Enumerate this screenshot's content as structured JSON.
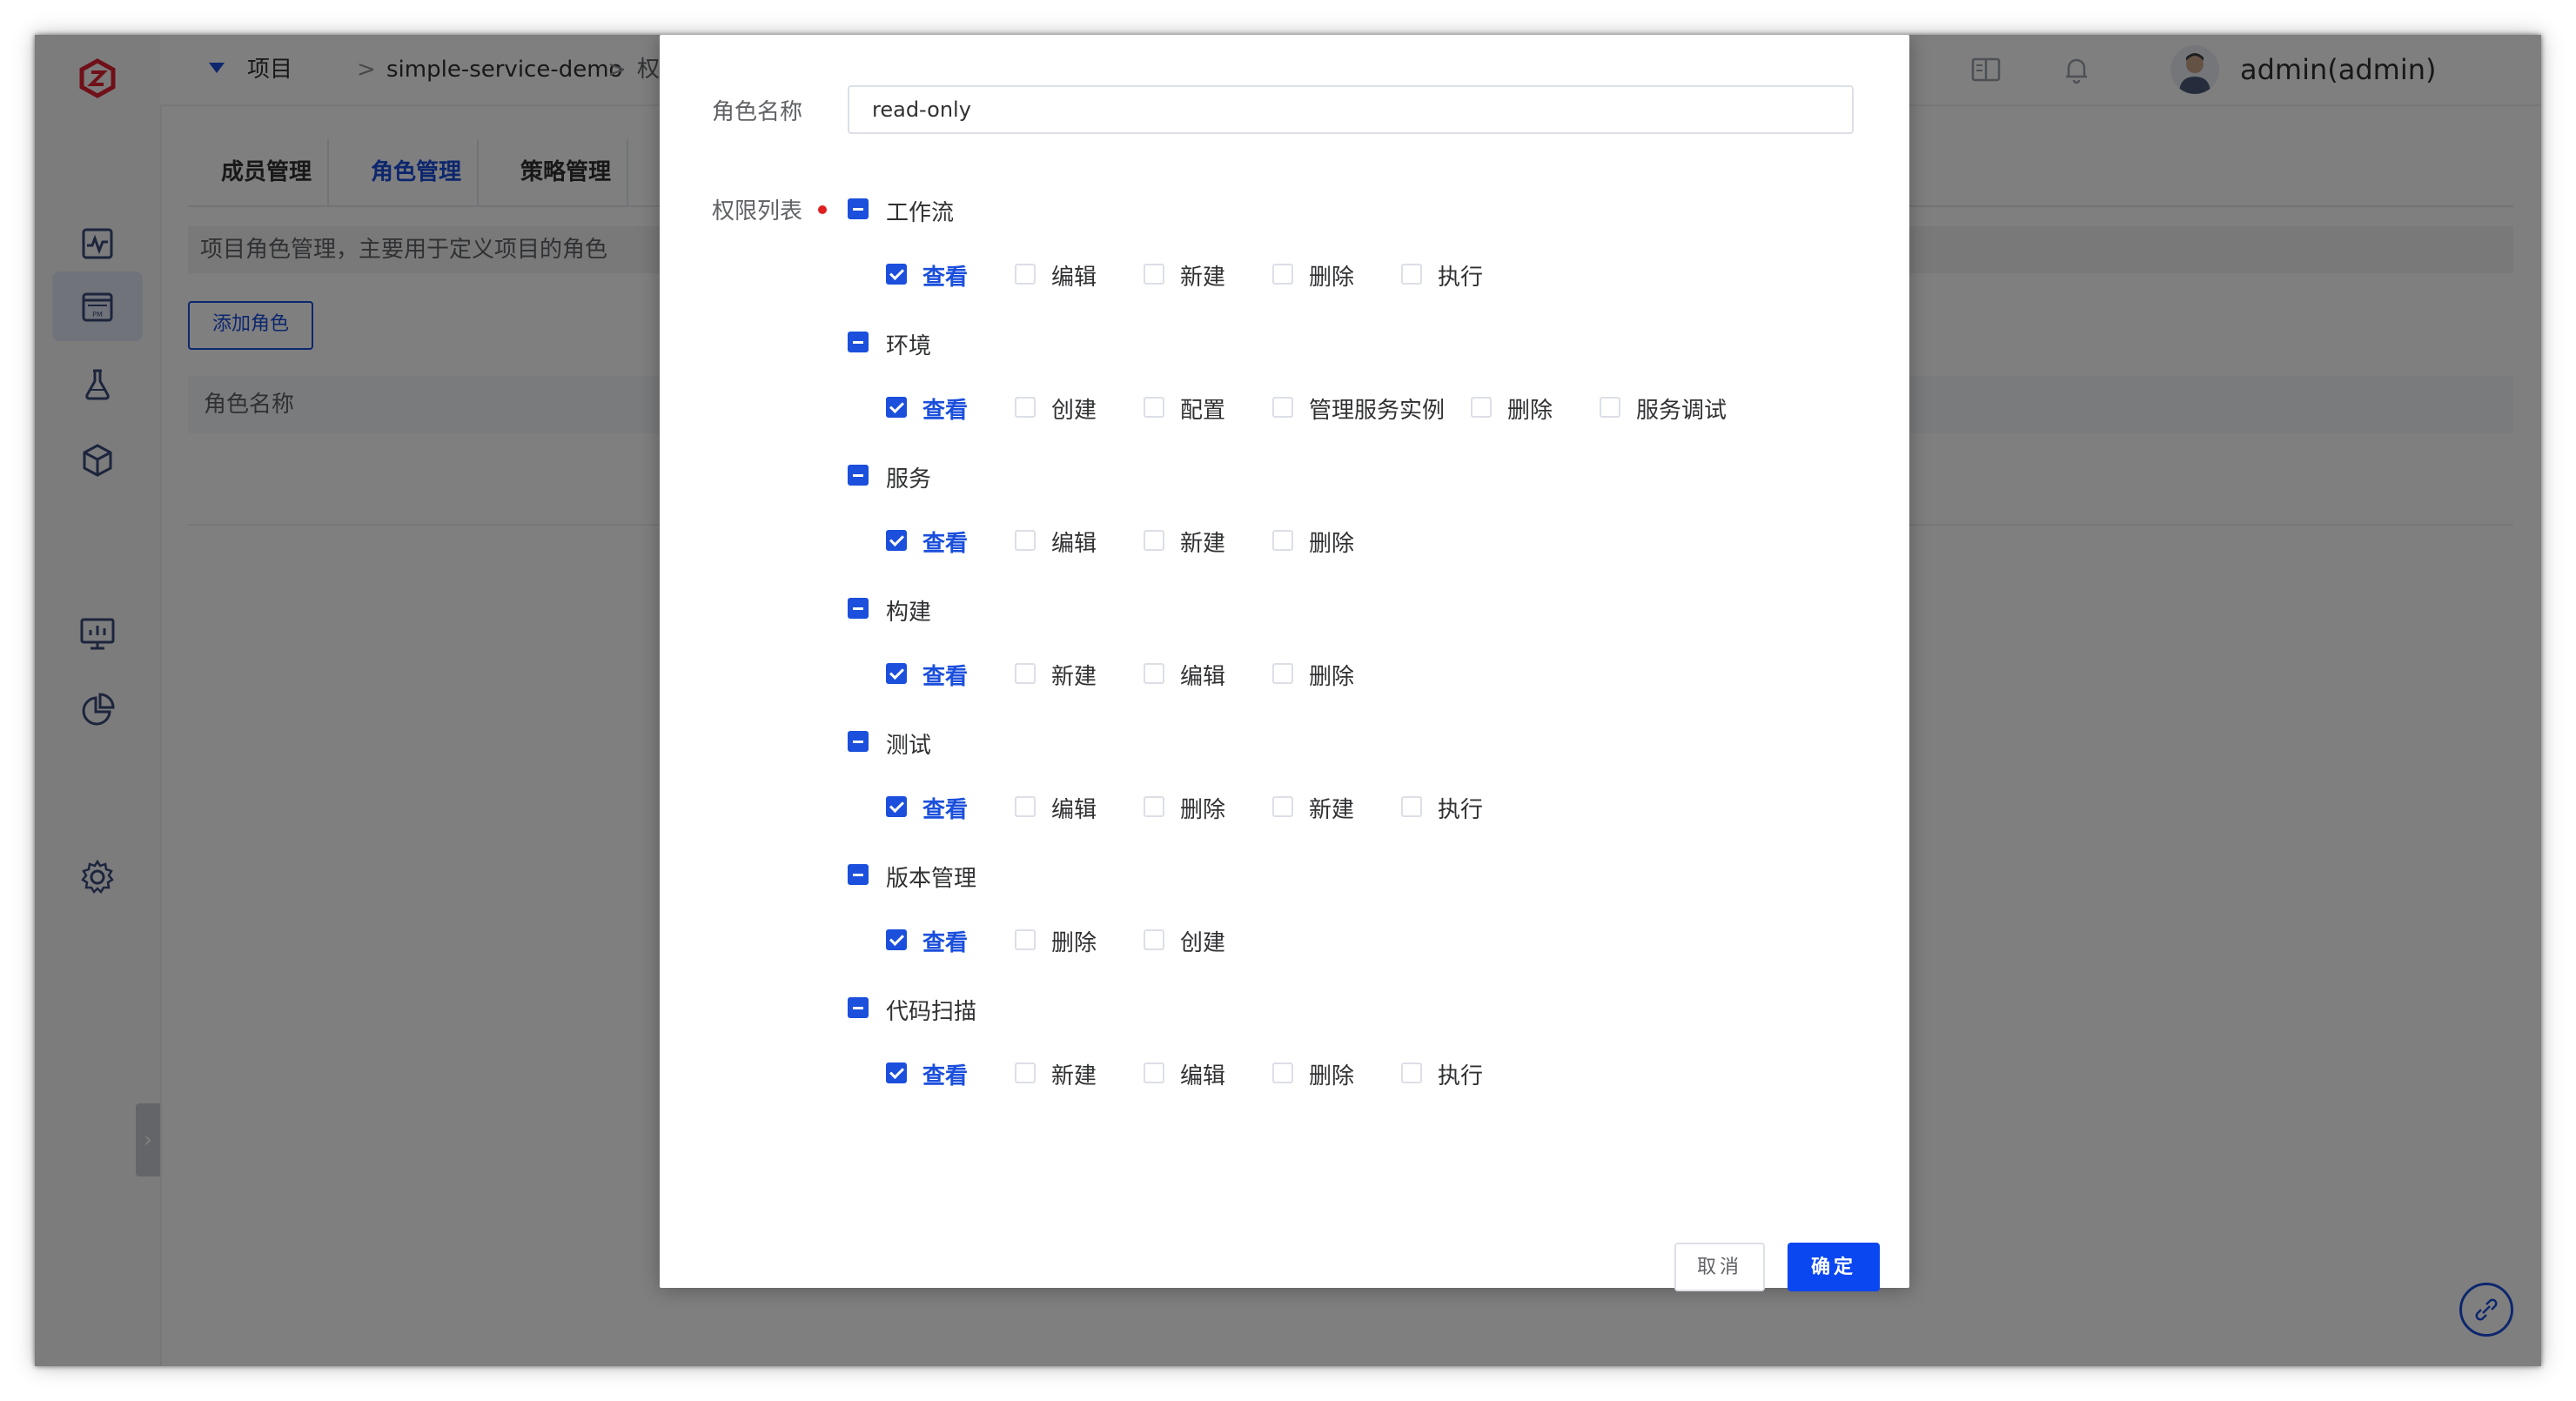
{
  "header": {
    "breadcrumb": [
      "项目",
      "simple-service-demo",
      "权限管"
    ],
    "separator": ">",
    "username": "admin(admin)",
    "more": "⋮"
  },
  "sidebar": {
    "icons": [
      "zadig-logo-icon",
      "activity-icon",
      "project-pm-icon",
      "flask-icon",
      "package-icon",
      "monitor-icon",
      "pie-chart-icon",
      "gear-icon"
    ],
    "collapse": "›"
  },
  "page": {
    "tabs": [
      {
        "label": "成员管理"
      },
      {
        "label": "角色管理"
      },
      {
        "label": "策略管理"
      }
    ],
    "active_tab": "角色管理",
    "description": "项目角色管理，主要用于定义项目的角色",
    "add_role_label": "添加角色",
    "table_header": "角色名称"
  },
  "dialog": {
    "role_name_label": "角色名称",
    "role_name_value": "read-only",
    "permission_list_label": "权限列表",
    "groups": [
      {
        "label": "工作流",
        "permissions": [
          {
            "label": "查看",
            "checked": true
          },
          {
            "label": "编辑",
            "checked": false
          },
          {
            "label": "新建",
            "checked": false
          },
          {
            "label": "删除",
            "checked": false
          },
          {
            "label": "执行",
            "checked": false
          }
        ]
      },
      {
        "label": "环境",
        "permissions": [
          {
            "label": "查看",
            "checked": true
          },
          {
            "label": "创建",
            "checked": false
          },
          {
            "label": "配置",
            "checked": false
          },
          {
            "label": "管理服务实例",
            "checked": false
          },
          {
            "label": "删除",
            "checked": false
          },
          {
            "label": "服务调试",
            "checked": false
          }
        ]
      },
      {
        "label": "服务",
        "permissions": [
          {
            "label": "查看",
            "checked": true
          },
          {
            "label": "编辑",
            "checked": false
          },
          {
            "label": "新建",
            "checked": false
          },
          {
            "label": "删除",
            "checked": false
          }
        ]
      },
      {
        "label": "构建",
        "permissions": [
          {
            "label": "查看",
            "checked": true
          },
          {
            "label": "新建",
            "checked": false
          },
          {
            "label": "编辑",
            "checked": false
          },
          {
            "label": "删除",
            "checked": false
          }
        ]
      },
      {
        "label": "测试",
        "permissions": [
          {
            "label": "查看",
            "checked": true
          },
          {
            "label": "编辑",
            "checked": false
          },
          {
            "label": "删除",
            "checked": false
          },
          {
            "label": "新建",
            "checked": false
          },
          {
            "label": "执行",
            "checked": false
          }
        ]
      },
      {
        "label": "版本管理",
        "permissions": [
          {
            "label": "查看",
            "checked": true
          },
          {
            "label": "删除",
            "checked": false
          },
          {
            "label": "创建",
            "checked": false
          }
        ]
      },
      {
        "label": "代码扫描",
        "permissions": [
          {
            "label": "查看",
            "checked": true
          },
          {
            "label": "新建",
            "checked": false
          },
          {
            "label": "编辑",
            "checked": false
          },
          {
            "label": "删除",
            "checked": false
          },
          {
            "label": "执行",
            "checked": false
          }
        ]
      }
    ],
    "cancel_label": "取消",
    "confirm_label": "确定"
  },
  "colors": {
    "primary": "#1b4fdc",
    "confirm_button": "#0a47f0",
    "logo_red": "#e02030",
    "required": "#e02020",
    "overlay": "rgba(0,0,0,0.5)"
  }
}
